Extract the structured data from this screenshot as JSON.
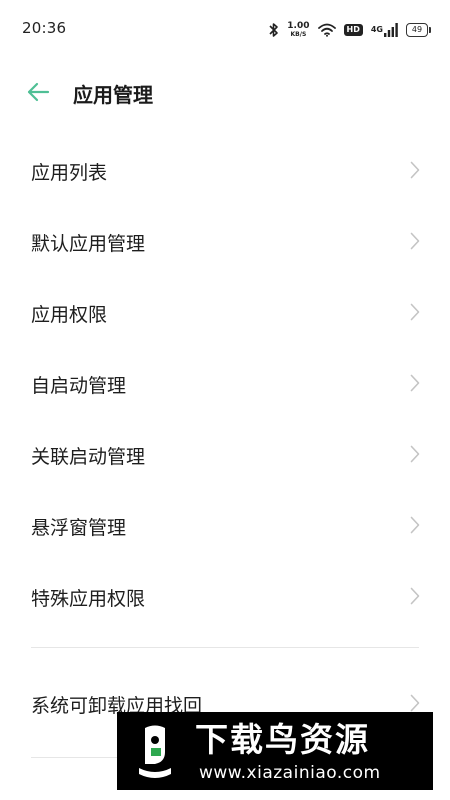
{
  "status_bar": {
    "time": "20:36",
    "net_speed_value": "1.00",
    "net_speed_unit": "KB/S",
    "hd_label": "HD",
    "network_label": "4G",
    "battery_level": "49"
  },
  "header": {
    "title": "应用管理",
    "back_icon": "arrow-left-icon",
    "accent_color": "#4fbf95"
  },
  "menu": {
    "items": [
      {
        "label": "应用列表"
      },
      {
        "label": "默认应用管理"
      },
      {
        "label": "应用权限"
      },
      {
        "label": "自启动管理"
      },
      {
        "label": "关联启动管理"
      },
      {
        "label": "悬浮窗管理"
      },
      {
        "label": "特殊应用权限"
      }
    ],
    "section2": [
      {
        "label": "系统可卸载应用找回"
      }
    ]
  },
  "watermark": {
    "title": "下载鸟资源",
    "url": "www.xiazainiao.com"
  }
}
